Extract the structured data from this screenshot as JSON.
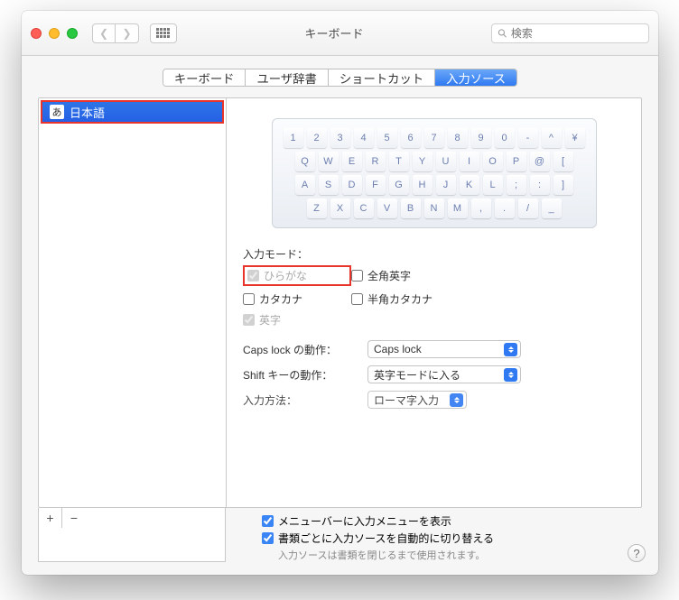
{
  "window": {
    "title": "キーボード"
  },
  "search": {
    "placeholder": "検索"
  },
  "tabs": [
    "キーボード",
    "ユーザ辞書",
    "ショートカット",
    "入力ソース"
  ],
  "tab_active_index": 3,
  "sources": [
    {
      "icon": "あ",
      "label": "日本語"
    }
  ],
  "keyboard_rows": [
    [
      "1",
      "2",
      "3",
      "4",
      "5",
      "6",
      "7",
      "8",
      "9",
      "0",
      "-",
      "^",
      "¥"
    ],
    [
      "Q",
      "W",
      "E",
      "R",
      "T",
      "Y",
      "U",
      "I",
      "O",
      "P",
      "@",
      "["
    ],
    [
      "A",
      "S",
      "D",
      "F",
      "G",
      "H",
      "J",
      "K",
      "L",
      ";",
      ":",
      "]"
    ],
    [
      "Z",
      "X",
      "C",
      "V",
      "B",
      "N",
      "M",
      ",",
      ".",
      "/",
      "_"
    ]
  ],
  "input_modes": {
    "label": "入力モード：",
    "hiragana": "ひらがな",
    "zenkaku_eiji": "全角英字",
    "katakana": "カタカナ",
    "hankaku_katakana": "半角カタカナ",
    "eiji": "英字"
  },
  "capslock": {
    "label": "Caps lock の動作：",
    "value": "Caps lock"
  },
  "shift": {
    "label": "Shift キーの動作：",
    "value": "英字モードに入る"
  },
  "method": {
    "label": "入力方法：",
    "value": "ローマ字入力"
  },
  "footer": {
    "show_menu": "メニューバーに入力メニューを表示",
    "auto_switch": "書類ごとに入力ソースを自動的に切り替える",
    "note": "入力ソースは書類を閉じるまで使用されます。"
  },
  "buttons": {
    "add": "+",
    "remove": "−"
  }
}
